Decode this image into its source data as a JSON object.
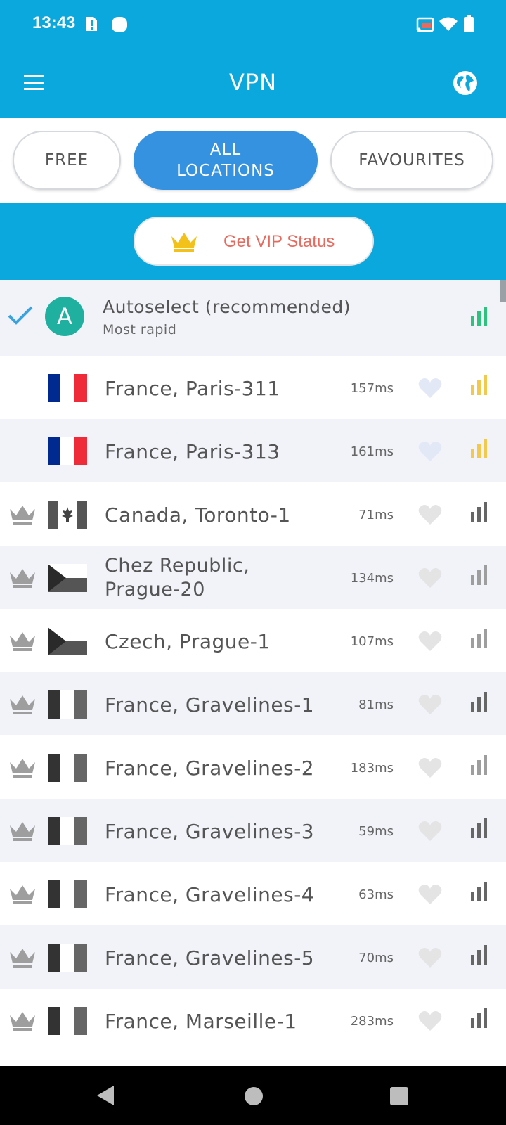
{
  "status_bar": {
    "time": "13:43",
    "icons": [
      "notification-alert-icon",
      "app-circle-icon",
      "cast-icon",
      "wifi-icon",
      "battery-icon"
    ]
  },
  "app_bar": {
    "title": "VPN",
    "menu_icon": "hamburger-menu-icon",
    "globe_icon": "globe-icon"
  },
  "tabs": [
    {
      "label": "FREE",
      "active": false
    },
    {
      "label": "ALL\nLOCATIONS",
      "active": true
    },
    {
      "label": "FAVOURITES",
      "active": false
    }
  ],
  "vip": {
    "label": "Get VIP Status",
    "icon": "crown-icon",
    "color": "#e86a5e"
  },
  "autoselect": {
    "title": "Autoselect (recommended)",
    "subtitle": "Most rapid",
    "avatar_letter": "A",
    "selected": true,
    "signal_color": "#2ec27e"
  },
  "servers": [
    {
      "name": "France, Paris-311",
      "ping": "157ms",
      "flag": "fr",
      "vip": false,
      "signal_color": "#f2c94c",
      "heart_color": "#e3e8f7"
    },
    {
      "name": "France, Paris-313",
      "ping": "161ms",
      "flag": "fr",
      "vip": false,
      "signal_color": "#f2c94c",
      "heart_color": "#e3e8f7"
    },
    {
      "name": "Canada, Toronto-1",
      "ping": "71ms",
      "flag": "ca",
      "vip": true,
      "signal_color": "#666666",
      "heart_color": "#e4e4e4"
    },
    {
      "name": "Chez Republic,\nPrague-20",
      "ping": "134ms",
      "flag": "cz",
      "vip": true,
      "signal_color": "#9e9e9e",
      "heart_color": "#e4e4e4"
    },
    {
      "name": "Czech, Prague-1",
      "ping": "107ms",
      "flag": "cz",
      "vip": true,
      "signal_color": "#9e9e9e",
      "heart_color": "#e4e4e4"
    },
    {
      "name": "France, Gravelines-1",
      "ping": "81ms",
      "flag": "fr-gray",
      "vip": true,
      "signal_color": "#666666",
      "heart_color": "#e4e4e4"
    },
    {
      "name": "France, Gravelines-2",
      "ping": "183ms",
      "flag": "fr-gray",
      "vip": true,
      "signal_color": "#9e9e9e",
      "heart_color": "#e4e4e4"
    },
    {
      "name": "France, Gravelines-3",
      "ping": "59ms",
      "flag": "fr-gray",
      "vip": true,
      "signal_color": "#666666",
      "heart_color": "#e4e4e4"
    },
    {
      "name": "France, Gravelines-4",
      "ping": "63ms",
      "flag": "fr-gray",
      "vip": true,
      "signal_color": "#666666",
      "heart_color": "#e4e4e4"
    },
    {
      "name": "France, Gravelines-5",
      "ping": "70ms",
      "flag": "fr-gray",
      "vip": true,
      "signal_color": "#666666",
      "heart_color": "#e4e4e4"
    },
    {
      "name": "France, Marseille-1",
      "ping": "283ms",
      "flag": "fr-gray",
      "vip": true,
      "signal_color": "#666666",
      "heart_color": "#e4e4e4"
    }
  ],
  "nav_bar": {
    "icons": [
      "back-icon",
      "home-icon",
      "recents-icon"
    ]
  }
}
